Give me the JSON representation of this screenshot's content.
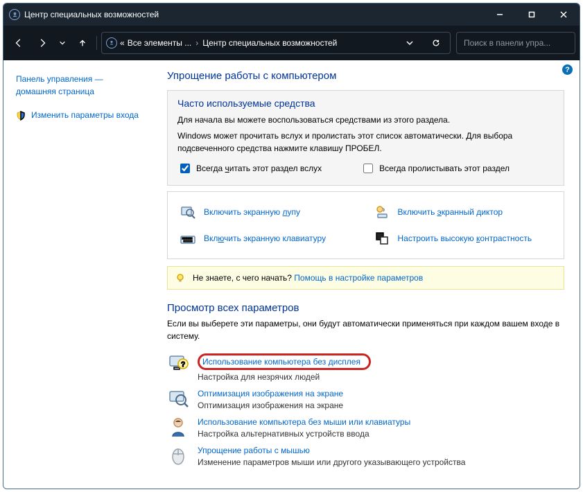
{
  "titlebar": {
    "title": "Центр специальных возможностей"
  },
  "address": {
    "crumb_prefix": "«",
    "crumb1": "Все элементы ...",
    "crumb2": "Центр специальных возможностей",
    "search_placeholder": "Поиск в панели упра..."
  },
  "sidebar": {
    "home_line1": "Панель управления —",
    "home_line2": "домашняя страница",
    "change_login": "Изменить параметры входа"
  },
  "main": {
    "help_q": "?",
    "h1": "Упрощение работы с компьютером",
    "tools": {
      "heading": "Часто используемые средства",
      "p1": "Для начала вы можете воспользоваться средствами из этого раздела.",
      "p2": "Windows может прочитать вслух и пролистать этот список автоматически. Для выбора подсвеченного средства нажмите клавишу ПРОБЕЛ.",
      "check_read_pre": "Всегда ",
      "check_read_u": "ч",
      "check_read_post": "итать этот раздел вслух",
      "check_scroll": "Всегда пролистывать этот раздел"
    },
    "toollinks": {
      "magnifier_pre": "Включить экранную ",
      "magnifier_u": "л",
      "magnifier_post": "упу",
      "keyboard_pre": "Вкл",
      "keyboard_u": "ю",
      "keyboard_post": "чить экранную клавиатуру",
      "narrator_pre": "Включить ",
      "narrator_u": "э",
      "narrator_post": "кранный диктор",
      "contrast_pre": "Настроить высокую ",
      "contrast_u": "к",
      "contrast_post": "онтрастность"
    },
    "hint": {
      "q": "Не знаете, с чего начать? ",
      "link": "Помощь в настройке параметров"
    },
    "all": {
      "heading": "Просмотр всех параметров",
      "desc": "Если вы выберете эти параметры, они будут автоматически применяться при каждом вашем входе в систему."
    },
    "items": {
      "i1_title": "Использование компьютера без дисплея",
      "i1_desc": "Настройка для незрячих людей",
      "i2_title": "Оптимизация изображения на экране",
      "i2_desc": "Оптимизация изображения на экране",
      "i3_title": "Использование компьютера без мыши или клавиатуры",
      "i3_desc": "Настройка альтернативных устройств ввода",
      "i4_title": "Упрощение работы с мышью",
      "i4_desc": "Изменение параметров мыши или другого указывающего устройства"
    }
  }
}
